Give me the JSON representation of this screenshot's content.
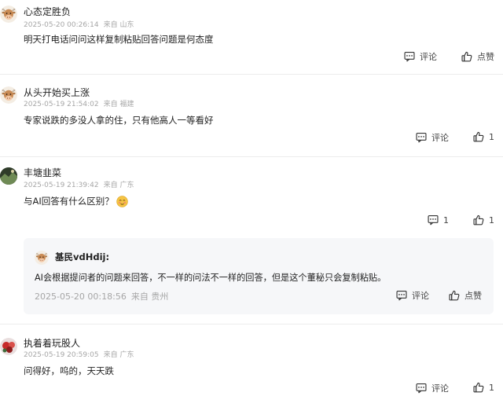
{
  "comments": [
    {
      "name": "心态定胜负",
      "time": "2025-05-20 00:26:14",
      "location": "来自 山东",
      "text": "明天打电话问问这样复制粘贴回答问题是何态度",
      "comment_label": "评论",
      "like_label": "点赞"
    },
    {
      "name": "从头开始买上涨",
      "time": "2025-05-19 21:54:02",
      "location": "来自 福建",
      "text": "专家说跌的多没人拿的住，只有他高人一等看好",
      "comment_label": "评论",
      "like_count": "1"
    },
    {
      "name": "丰塘韭菜",
      "time": "2025-05-19 21:39:42",
      "location": "来自 广东",
      "text": "与AI回答有什么区别？",
      "comment_count": "1",
      "like_count": "1"
    },
    {
      "name": "执着着玩股人",
      "time": "2025-05-19 20:59:05",
      "location": "来自 广东",
      "text": "问得好，呜的，天天跌",
      "comment_label": "评论",
      "like_count": "1"
    }
  ],
  "reply": {
    "name": "基民vdHdij:",
    "text": "AI会根据提问者的问题来回答，不一样的问法不一样的回答，但是这个董秘只会复制粘贴。",
    "time": "2025-05-20 00:18:56",
    "location": "来自 贵州",
    "comment_label": "评论",
    "like_label": "点赞"
  },
  "icons": {
    "comment": "comment-bubble-icon",
    "like": "thumbs-up-icon",
    "emoji": "blushing-face-emoji-icon",
    "avatar_default": "cow-avatar-icon"
  }
}
